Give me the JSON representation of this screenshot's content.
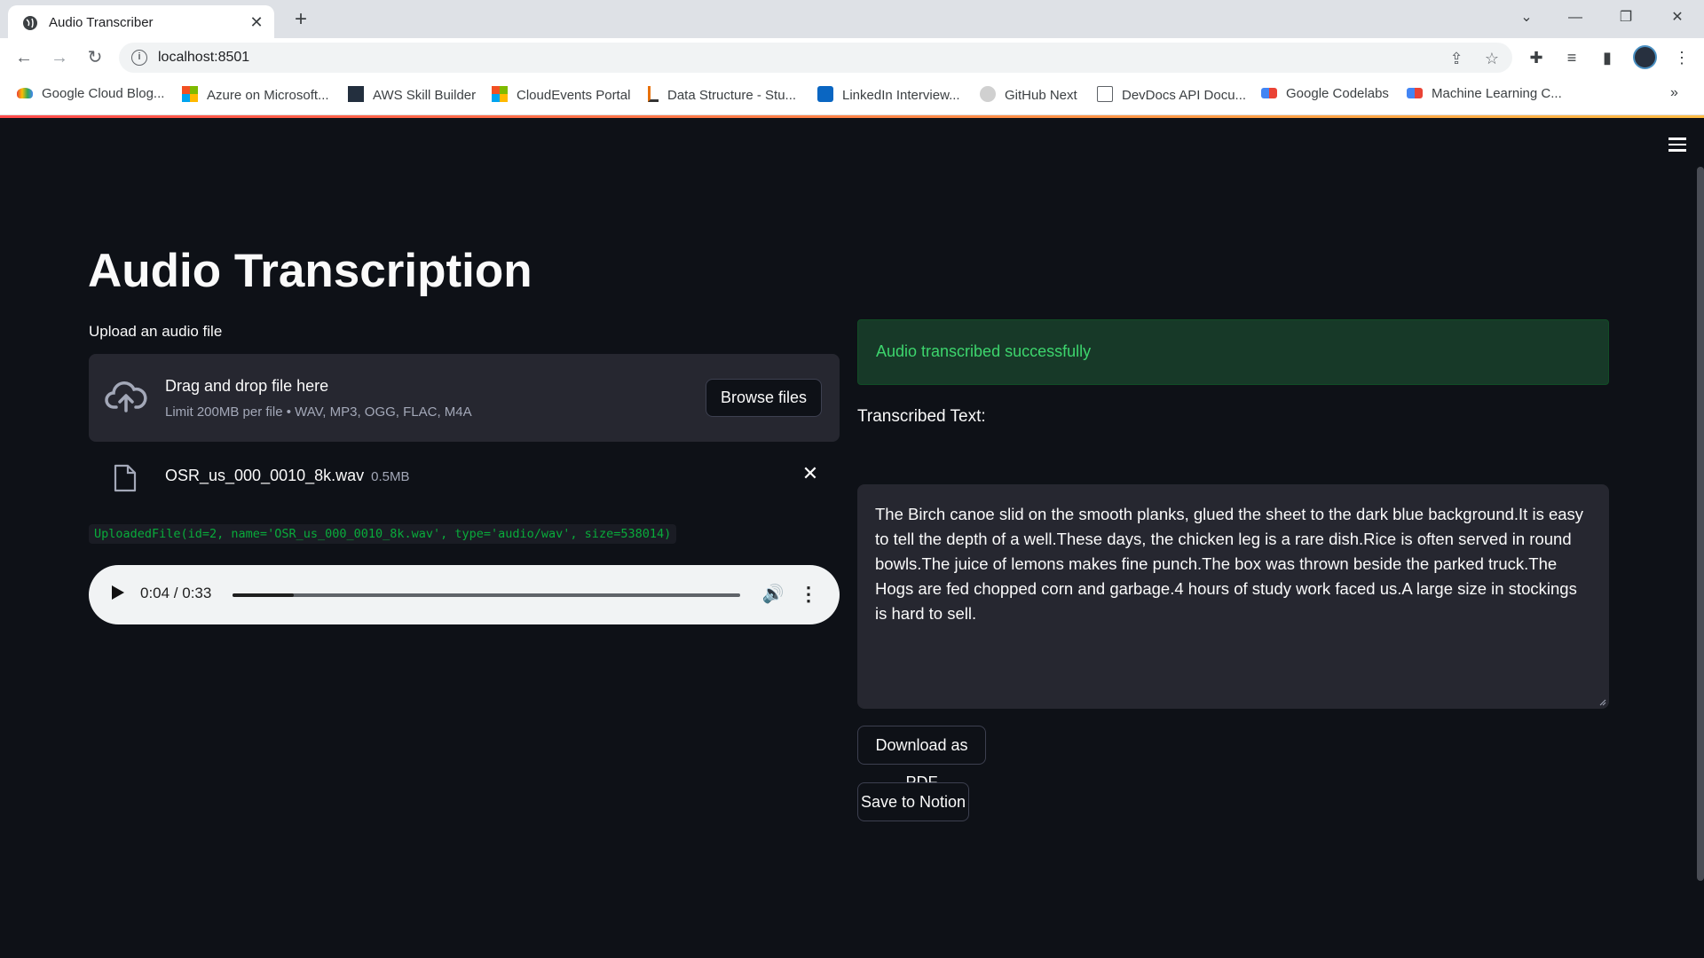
{
  "browser": {
    "tab_title": "Audio Transcriber",
    "url": "localhost:8501",
    "bookmarks": [
      {
        "label": "Google Cloud Blog...",
        "icon": "google-cloud-icon",
        "color": "#4285f4"
      },
      {
        "label": "Azure on Microsoft...",
        "icon": "microsoft-icon",
        "color": "#f25022"
      },
      {
        "label": "AWS Skill Builder",
        "icon": "aws-icon",
        "color": "#232f3e"
      },
      {
        "label": "CloudEvents Portal",
        "icon": "microsoft-icon",
        "color": "#f25022"
      },
      {
        "label": "Data Structure - Stu...",
        "icon": "data-structure-icon",
        "color": "#e8710a"
      },
      {
        "label": "LinkedIn Interview...",
        "icon": "linkedin-icon",
        "color": "#0a66c2"
      },
      {
        "label": "GitHub Next",
        "icon": "github-icon",
        "color": "#bdbdbd"
      },
      {
        "label": "DevDocs API Docu...",
        "icon": "devdocs-icon",
        "color": "#5f6368"
      },
      {
        "label": "Google Codelabs",
        "icon": "codelabs-icon",
        "color": "#4285f4"
      },
      {
        "label": "Machine Learning C...",
        "icon": "codelabs-icon",
        "color": "#4285f4"
      }
    ],
    "bookmarks_more": "»"
  },
  "app": {
    "title": "Audio Transcription",
    "uploader": {
      "label": "Upload an audio file",
      "drag_text": "Drag and drop file here",
      "limit_text": "Limit 200MB per file • WAV, MP3, OGG, FLAC, M4A",
      "browse_label": "Browse files"
    },
    "file": {
      "name": "OSR_us_000_0010_8k.wav",
      "size": "0.5MB"
    },
    "uploaded_repr": "UploadedFile(id=2, name='OSR_us_000_0010_8k.wav', type='audio/wav', size=538014)",
    "audio": {
      "time": "0:04 / 0:33",
      "progress_fraction": 0.121
    },
    "success_message": "Audio transcribed successfully",
    "transcribed_label": "Transcribed Text:",
    "transcribed_text": "The Birch canoe slid on the smooth planks, glued the sheet to the dark blue background.It is easy to tell the depth of a well.These days, the chicken leg is a rare dish.Rice is often served in round bowls.The juice of lemons makes fine punch.The box was thrown beside the parked truck.The Hogs are fed chopped corn and garbage.4 hours of study work faced us.A large size in stockings is hard to sell.",
    "download_label": "Download as PDF",
    "notion_label": "Save to Notion"
  },
  "colors": {
    "background": "#0e1117",
    "success_text": "#3dd56d",
    "code_text": "#09ab3b"
  }
}
